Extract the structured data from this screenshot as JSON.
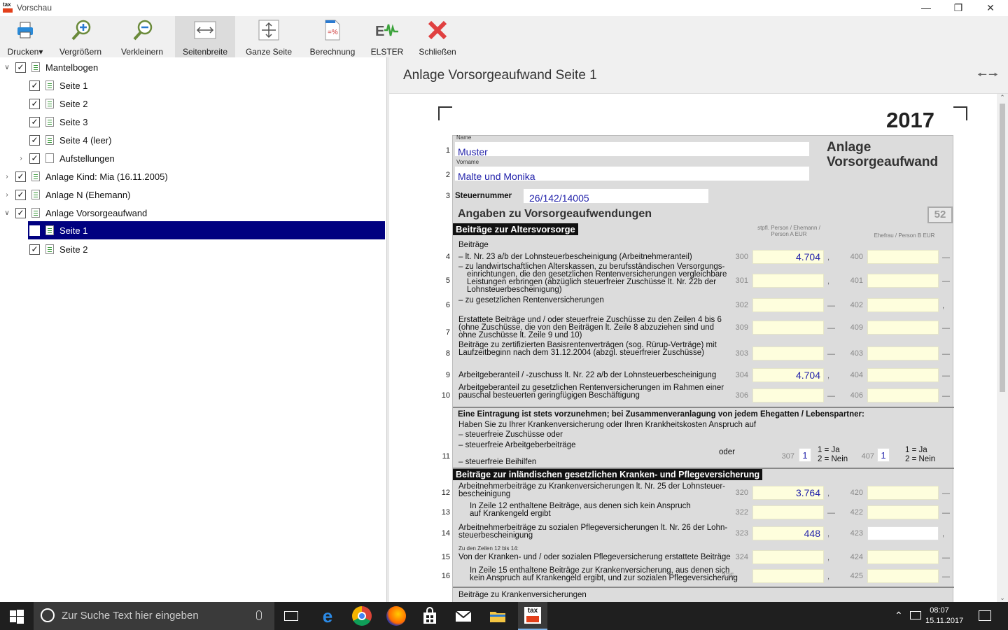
{
  "window": {
    "title": "Vorschau",
    "app_icon_text": "tax"
  },
  "toolbar": {
    "print": "Drucken",
    "zoom_in": "Vergrößern",
    "zoom_out": "Verkleinern",
    "page_width": "Seitenbreite",
    "whole_page": "Ganze Seite",
    "calculation": "Berechnung",
    "elster": "ELSTER",
    "close": "Schließen"
  },
  "tree": [
    {
      "label": "Mantelbogen",
      "checked": true
    },
    {
      "label": "Seite 1",
      "checked": true
    },
    {
      "label": "Seite 2",
      "checked": true
    },
    {
      "label": "Seite 3",
      "checked": true
    },
    {
      "label": "Seite 4 (leer)",
      "checked": true
    },
    {
      "label": "Aufstellungen",
      "checked": true
    },
    {
      "label": "Anlage Kind: Mia (16.11.2005)",
      "checked": true
    },
    {
      "label": "Anlage N (Ehemann)",
      "checked": true
    },
    {
      "label": "Anlage Vorsorgeaufwand",
      "checked": true
    },
    {
      "label": "Seite 1",
      "checked": true,
      "selected": true
    },
    {
      "label": "Seite 2",
      "checked": true
    }
  ],
  "preview": {
    "heading": "Anlage Vorsorgeaufwand Seite 1",
    "year": "2017",
    "form_title_1": "Anlage",
    "form_title_2": "Vorsorgeaufwand",
    "name_label": "Name",
    "name": "Muster",
    "vorname_label": "Vorname",
    "vorname": "Malte und Monika",
    "steuernummer_label": "Steuernummer",
    "steuernummer": "26/142/14005",
    "section_title": "Angaben zu Vorsorgeaufwendungen",
    "form_number": "52",
    "bar_1": "Beiträge zur Altersvorsorge",
    "col_a": "stpfl. Person / Ehemann / Person A EUR",
    "col_b": "Ehefrau / Person B EUR",
    "beitraege": "Beiträge",
    "eintrag_head": "Eine Eintragung ist stets vorzunehmen; bei Zusammenveranlagung von jedem Ehegatten / Lebenspartner:",
    "eintrag_q": "Haben Sie zu Ihrer Krankenversicherung oder Ihren Krankheitskosten Anspruch auf",
    "opt_ja": "1 = Ja",
    "opt_nein": "2 = Nein",
    "bar_2": "Beiträge zur inländischen gesetzlichen Kranken- und Pflegeversicherung",
    "footer_text": "Beiträge zu Krankenversicherungen"
  },
  "lines": [
    {
      "no": "4",
      "text": "– lt. Nr. 23 a/b der Lohnsteuerbescheinigung (Arbeitnehmeranteil)",
      "ca": "300",
      "va": "4.704",
      "cb": "400"
    },
    {
      "no": "5",
      "text": "– zu landwirtschaftlichen Alterskassen, zu berufsständischen Versorgungs-",
      "text2": "einrichtungen, die den gesetzlichen Rentenversicherungen vergleichbare",
      "text3": "Leistungen erbringen (abzüglich steuerfreier Zuschüsse lt. Nr. 22b der",
      "text4": "Lohnsteuerbescheinigung)",
      "ca": "301",
      "va": "",
      "cb": "401"
    },
    {
      "no": "6",
      "text": "– zu gesetzlichen Rentenversicherungen",
      "ca": "302",
      "va": "",
      "cb": "402"
    },
    {
      "no": "7",
      "text": "Erstattete Beiträge und / oder steuerfreie Zuschüsse zu den Zeilen 4 bis 6",
      "text2": "(ohne Zuschüsse, die von den Beiträgen lt. Zeile 8 abzuziehen sind und",
      "text3": "ohne Zuschüsse lt. Zeile 9 und 10)",
      "ca": "309",
      "va": "",
      "cb": "409"
    },
    {
      "no": "8",
      "text": "Beiträge zu zertifizierten Basisrentenverträgen (sog. Rürup-Verträge) mit",
      "text2": "Laufzeitbeginn nach dem 31.12.2004 (abzgl. steuerfreier Zuschüsse)",
      "ca": "303",
      "va": "",
      "cb": "403"
    },
    {
      "no": "9",
      "text": "Arbeitgeberanteil / -zuschuss lt. Nr. 22 a/b der Lohnsteuerbescheinigung",
      "ca": "304",
      "va": "4.704",
      "cb": "404"
    },
    {
      "no": "10",
      "text": "Arbeitgeberanteil zu gesetzlichen Rentenversicherungen im Rahmen einer",
      "text2": "pauschal besteuerten geringfügigen Beschäftigung",
      "ca": "306",
      "va": "",
      "cb": "406"
    },
    {
      "no": "11",
      "text": "– steuerfreie Beihilfen",
      "ca": "307",
      "va": "1",
      "cb": "407",
      "vb": "1"
    },
    {
      "no": "12",
      "text": "Arbeitnehmerbeiträge zu Krankenversicherungen lt. Nr. 25 der Lohnsteuer-",
      "text2": "bescheinigung",
      "ca": "320",
      "va": "3.764",
      "cb": "420"
    },
    {
      "no": "13",
      "text": "In Zeile 12 enthaltene Beiträge, aus denen sich kein Anspruch",
      "text2": "auf Krankengeld ergibt",
      "ca": "322",
      "va": "",
      "cb": "422"
    },
    {
      "no": "14",
      "text": "Arbeitnehmerbeiträge zu sozialen Pflegeversicherungen lt. Nr. 26 der Lohn-",
      "text2": "steuerbescheinigung",
      "ca": "323",
      "va": "448",
      "cb": "423"
    },
    {
      "no": "15",
      "text": "Von der Kranken- und / oder sozialen Pflegeversicherung erstattete Beiträge",
      "ca": "324",
      "va": "",
      "cb": "424"
    },
    {
      "no": "16",
      "text": "In Zeile 15 enthaltene Beiträge zur Krankenversicherung, aus denen sich",
      "text2": "kein Anspruch auf Krankengeld ergibt, und zur sozialen Pflegeversicherung",
      "ca": "325",
      "va": "",
      "cb": "425"
    }
  ],
  "sub11": {
    "a": "– steuerfreie Zuschüsse",
    "b": "– steuerfreie Arbeitgeberbeiträge",
    "b_or": "oder",
    "a_or": "oder"
  },
  "line15_pre": "Zu den Zeilen 12 bis 14:",
  "taskbar": {
    "search_placeholder": "Zur Suche Text hier eingeben",
    "time": "08:07",
    "date": "15.11.2017"
  }
}
